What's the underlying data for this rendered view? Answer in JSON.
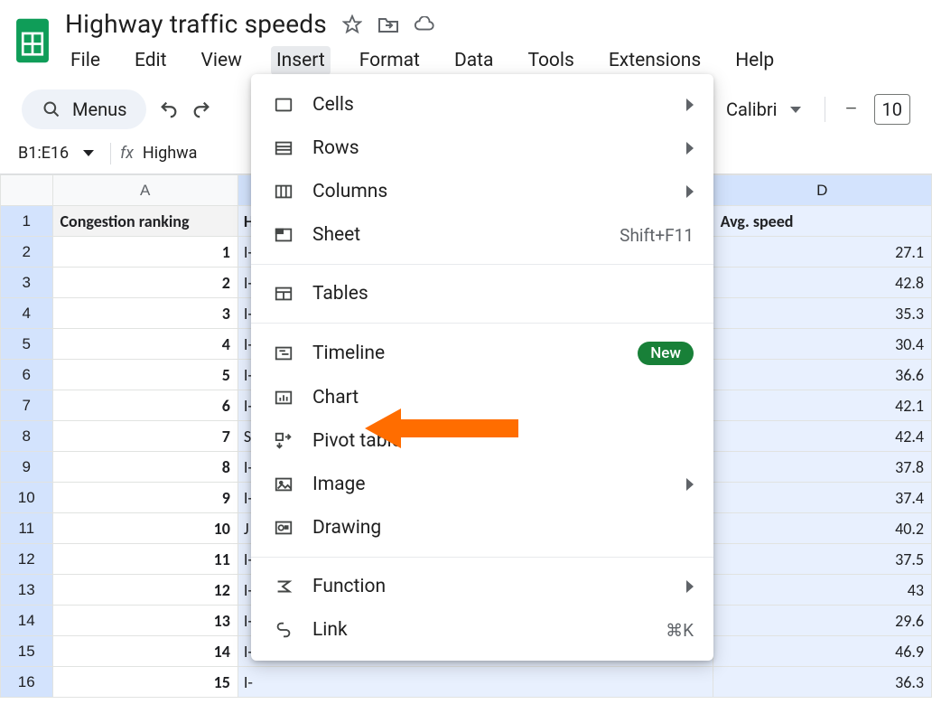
{
  "doc_title": "Highway traffic speeds",
  "menubar": [
    "File",
    "Edit",
    "View",
    "Insert",
    "Format",
    "Data",
    "Tools",
    "Extensions",
    "Help"
  ],
  "active_menu_index": 3,
  "toolbar": {
    "menus_label": "Menus",
    "font_name": "Calibri",
    "font_size": "10",
    "minus": "−"
  },
  "namebox": "B1:E16",
  "fx_label": "fx",
  "fx_content": "Highwa",
  "columns": {
    "A": "A",
    "D": "D"
  },
  "header_row": {
    "A": "Congestion ranking",
    "B": "H",
    "D": "Avg. speed"
  },
  "rows": [
    {
      "n": "2",
      "a": "1",
      "b": "I-",
      "d": "27.1"
    },
    {
      "n": "3",
      "a": "2",
      "b": "I-",
      "d": "42.8"
    },
    {
      "n": "4",
      "a": "3",
      "b": "I-",
      "d": "35.3"
    },
    {
      "n": "5",
      "a": "4",
      "b": "I-",
      "d": "30.4"
    },
    {
      "n": "6",
      "a": "5",
      "b": "I-",
      "d": "36.6"
    },
    {
      "n": "7",
      "a": "6",
      "b": "I-",
      "d": "42.1"
    },
    {
      "n": "8",
      "a": "7",
      "b": "S",
      "d": "42.4"
    },
    {
      "n": "9",
      "a": "8",
      "b": "I-",
      "d": "37.8"
    },
    {
      "n": "10",
      "a": "9",
      "b": "I-",
      "d": "37.4"
    },
    {
      "n": "11",
      "a": "10",
      "b": "J",
      "d": "40.2"
    },
    {
      "n": "12",
      "a": "11",
      "b": "I-",
      "d": "37.5"
    },
    {
      "n": "13",
      "a": "12",
      "b": "I-",
      "d": "43"
    },
    {
      "n": "14",
      "a": "13",
      "b": "I-",
      "d": "29.6"
    },
    {
      "n": "15",
      "a": "14",
      "b": "I-",
      "d": "46.9"
    },
    {
      "n": "16",
      "a": "15",
      "b": "I-",
      "d": "36.3"
    }
  ],
  "insert_menu": {
    "group1": [
      {
        "icon": "cells",
        "label": "Cells",
        "submenu": true
      },
      {
        "icon": "rows",
        "label": "Rows",
        "submenu": true
      },
      {
        "icon": "columns",
        "label": "Columns",
        "submenu": true
      },
      {
        "icon": "sheet",
        "label": "Sheet",
        "accel": "Shift+F11"
      }
    ],
    "group2": [
      {
        "icon": "tables",
        "label": "Tables"
      }
    ],
    "group3": [
      {
        "icon": "timeline",
        "label": "Timeline",
        "badge": "New"
      },
      {
        "icon": "chart",
        "label": "Chart"
      },
      {
        "icon": "pivot",
        "label": "Pivot table"
      },
      {
        "icon": "image",
        "label": "Image",
        "submenu": true
      },
      {
        "icon": "drawing",
        "label": "Drawing"
      }
    ],
    "group4": [
      {
        "icon": "function",
        "label": "Function",
        "submenu": true
      },
      {
        "icon": "link",
        "label": "Link",
        "accel": "⌘K"
      }
    ]
  }
}
